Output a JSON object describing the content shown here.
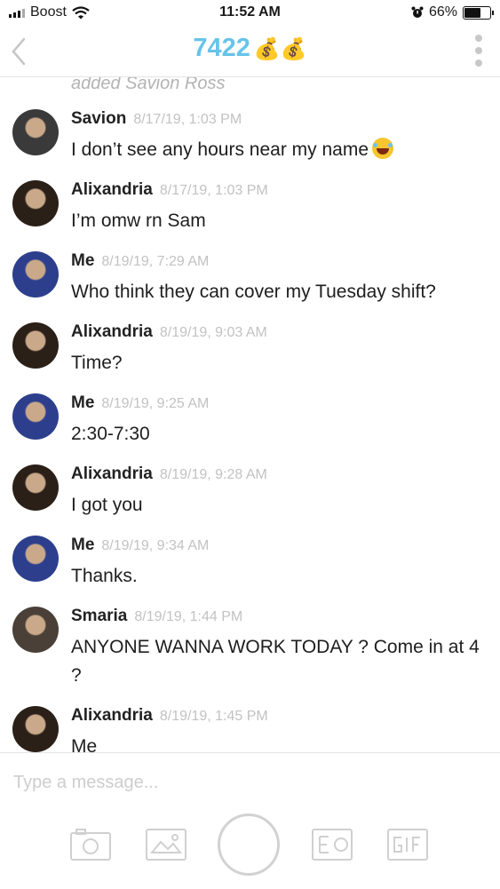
{
  "status_bar": {
    "carrier": "Boost",
    "time": "11:52 AM",
    "battery": "66%",
    "battery_level": 0.66
  },
  "header": {
    "title": "7422",
    "title_emoji": "💰💰"
  },
  "chat": {
    "system_message": "added Savion Ross",
    "messages": [
      {
        "sender": "Savion",
        "timestamp": "8/17/19, 1:03 PM",
        "text": "I don’t see any hours near my name",
        "emoji": "face-with-tears-of-joy",
        "avatar_color": "#3a3a3a"
      },
      {
        "sender": "Alixandria",
        "timestamp": "8/17/19, 1:03 PM",
        "text": "I’m omw rn Sam",
        "avatar_color": "#2b2018"
      },
      {
        "sender": "Me",
        "timestamp": "8/19/19, 7:29 AM",
        "text": "Who think they can cover my Tuesday shift?",
        "avatar_color": "#2d3f8c"
      },
      {
        "sender": "Alixandria",
        "timestamp": "8/19/19, 9:03 AM",
        "text": "Time?",
        "avatar_color": "#2b2018"
      },
      {
        "sender": "Me",
        "timestamp": "8/19/19, 9:25 AM",
        "text": "2:30-7:30",
        "avatar_color": "#2d3f8c"
      },
      {
        "sender": "Alixandria",
        "timestamp": "8/19/19, 9:28 AM",
        "text": "I got you",
        "avatar_color": "#2b2018"
      },
      {
        "sender": "Me",
        "timestamp": "8/19/19, 9:34 AM",
        "text": "Thanks.",
        "avatar_color": "#2d3f8c"
      },
      {
        "sender": "Smaria",
        "timestamp": "8/19/19, 1:44 PM",
        "text": "ANYONE WANNA WORK TODAY ? Come in at 4 ?",
        "avatar_color": "#4a4038"
      },
      {
        "sender": "Alixandria",
        "timestamp": "8/19/19, 1:45 PM",
        "text": "Me",
        "avatar_color": "#2b2018"
      }
    ]
  },
  "composer": {
    "placeholder": "Type a message..."
  }
}
